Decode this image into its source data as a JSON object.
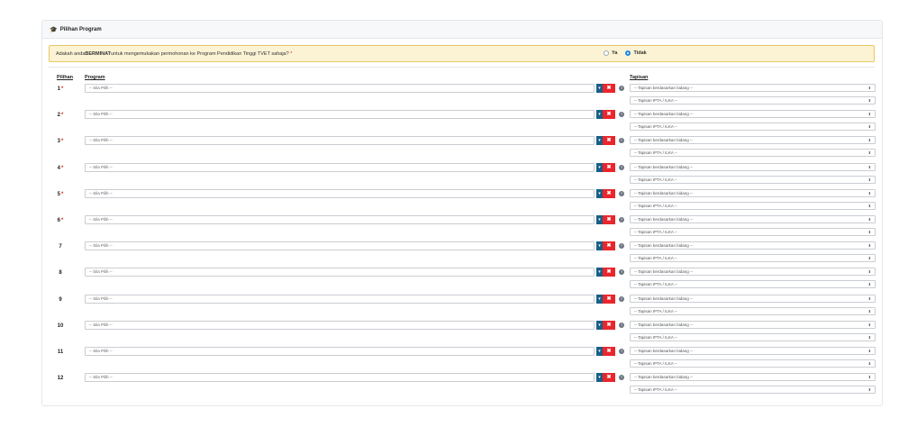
{
  "card": {
    "title": "Pilihan Program",
    "icon": "graduation-cap-icon"
  },
  "question": {
    "prefix": "Adakah anda ",
    "bold": "BERMINAT",
    "suffix": " untuk mengemukakan permohonan ke Program Pendidikan Tinggi TVET sahaja?",
    "required_mark": "*",
    "options": [
      "Ya",
      "Tidak"
    ],
    "selected": "Tidak"
  },
  "headers": {
    "pilihan": "Pilihan",
    "program": "Program",
    "tapisan": "Tapisan"
  },
  "rows": [
    {
      "no": "1",
      "required": true
    },
    {
      "no": "2",
      "required": true
    },
    {
      "no": "3",
      "required": true
    },
    {
      "no": "4",
      "required": true
    },
    {
      "no": "5",
      "required": true
    },
    {
      "no": "6",
      "required": true
    },
    {
      "no": "7",
      "required": false
    },
    {
      "no": "8",
      "required": false
    },
    {
      "no": "9",
      "required": false
    },
    {
      "no": "10",
      "required": false
    },
    {
      "no": "11",
      "required": false
    },
    {
      "no": "12",
      "required": false
    }
  ],
  "program_placeholder": "-- Sila Pilih --",
  "filter1_placeholder": "-- Tapisan berdasarkan bidang --",
  "filter2_placeholder": "-- Tapisan IPTA / ILKA --",
  "buttons": {
    "clear": "✖",
    "help": "?"
  },
  "colors": {
    "accent": "#1e88e5",
    "danger": "#e8262c",
    "primary_dark": "#1a5f87",
    "alert_bg": "#fcf3d4"
  }
}
